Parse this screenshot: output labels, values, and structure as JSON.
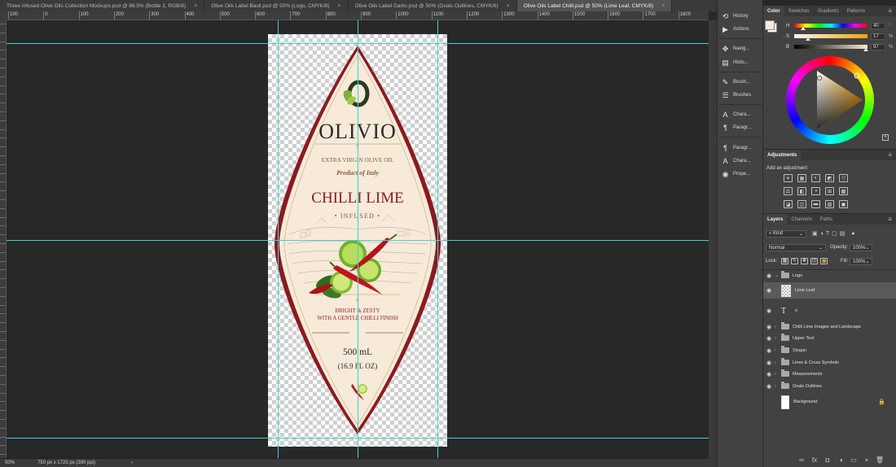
{
  "tabs": [
    {
      "label": "Three Infused Olive Oils Collection Mockups.psd @ 86.5% (Bottle 2, RGB/8)",
      "active": false
    },
    {
      "label": "Olive Oils Label Basil.psd @ 50% (Logo, CMYK/8)",
      "active": false
    },
    {
      "label": "Olive Oils Label Garlic.psd @ 50% (Ovals Outlines, CMYK/8)",
      "active": false
    },
    {
      "label": "Olive Oils Label Chilli.psd @ 50% (Lime Leaf, CMYK/8)",
      "active": true
    }
  ],
  "ruler_labels": [
    "100",
    "0",
    "100",
    "200",
    "300",
    "400",
    "500",
    "600",
    "700",
    "800",
    "900",
    "1000",
    "1100",
    "1200",
    "1300",
    "1400",
    "1500",
    "1600",
    "1700",
    "1800"
  ],
  "label": {
    "brand": "OLIVIO",
    "line1": "EXTRA VIRGIN OLIVE OIL",
    "line2": "Product of Italy",
    "flavor": "CHILLI LIME",
    "infused": "• INFUSED •",
    "slogan1": "BRIGHT & ZESTY",
    "slogan2": "WITH A GENTLE CHILLI FINISH",
    "volume": "500 mL",
    "volume_oz": "(16.9 FL OZ)",
    "colors": {
      "cream": "#f7ead8",
      "burgundy": "#8b1a1f",
      "brown": "#8a5a3a",
      "gold": "#b98a5a"
    }
  },
  "status": {
    "zoom": "50%",
    "doc_info": "750 px x 1725 px (300 ppi)",
    "arrow": "›"
  },
  "collapsed_panels": [
    {
      "icon": "history-icon",
      "glyph": "⟲",
      "label": "History"
    },
    {
      "icon": "actions-icon",
      "glyph": "▶",
      "label": "Actions"
    },
    {
      "icon": "navigator-icon",
      "glyph": "✥",
      "label": "Navig..."
    },
    {
      "icon": "histogram-icon",
      "glyph": "▤",
      "label": "Histo..."
    },
    {
      "icon": "brush-icon",
      "glyph": "✎",
      "label": "Brush..."
    },
    {
      "icon": "brushes-icon",
      "glyph": "☰",
      "label": "Brushes"
    },
    {
      "icon": "character-icon",
      "glyph": "A",
      "label": "Chara..."
    },
    {
      "icon": "paragraph-icon",
      "glyph": "¶",
      "label": "Paragr..."
    },
    {
      "icon": "paragraph-styles-icon",
      "glyph": "¶",
      "label": "Paragr..."
    },
    {
      "icon": "character-styles-icon",
      "glyph": "A",
      "label": "Chara..."
    },
    {
      "icon": "properties-icon",
      "glyph": "◉",
      "label": "Prope..."
    }
  ],
  "color_panel": {
    "tabs": [
      "Color",
      "Swatches",
      "Gradients",
      "Patterns"
    ],
    "h_label": "H",
    "h_value": "40",
    "h_unit": "°",
    "s_label": "S",
    "s_value": "17",
    "s_unit": "%",
    "b_label": "B",
    "b_value": "97",
    "b_unit": "%",
    "foreground": "#f7ead8",
    "background": "#ffffff"
  },
  "adjustments": {
    "title": "Adjustments",
    "hint": "Add an adjustment",
    "icons": [
      "☀",
      "▦",
      "◐",
      "◩",
      "▽",
      "",
      "⚖",
      "◧",
      "◑",
      "⊞",
      "▩",
      "",
      "◪",
      "◫",
      "▬",
      "▧",
      "▣",
      ""
    ]
  },
  "layers_panel": {
    "tabs": [
      "Layers",
      "Channels",
      "Paths"
    ],
    "filter_label": "Kind",
    "blend_mode": "Normal",
    "opacity_label": "Opacity:",
    "opacity_value": "100%",
    "lock_label": "Lock:",
    "fill_label": "Fill:",
    "fill_value": "100%",
    "layers": [
      {
        "name": "Logo",
        "type": "folder-open",
        "selected": false
      },
      {
        "name": "Lime Leaf",
        "type": "pixel",
        "selected": true
      },
      {
        "name": "o",
        "type": "text",
        "selected": false
      },
      {
        "name": "Chilli Lime Images and Landscape",
        "type": "folder",
        "selected": false
      },
      {
        "name": "Upper Text",
        "type": "folder",
        "selected": false
      },
      {
        "name": "Slogan",
        "type": "folder",
        "selected": false
      },
      {
        "name": "Lines & Cross Symbols",
        "type": "folder",
        "selected": false
      },
      {
        "name": "Measurements",
        "type": "folder",
        "selected": false
      },
      {
        "name": "Ovals Outlines",
        "type": "folder",
        "selected": false
      },
      {
        "name": "Background",
        "type": "background",
        "selected": false
      }
    ],
    "bottom_icons": [
      "∞",
      "fx",
      "◘",
      "◑",
      "▭",
      "+",
      "🗑"
    ]
  }
}
